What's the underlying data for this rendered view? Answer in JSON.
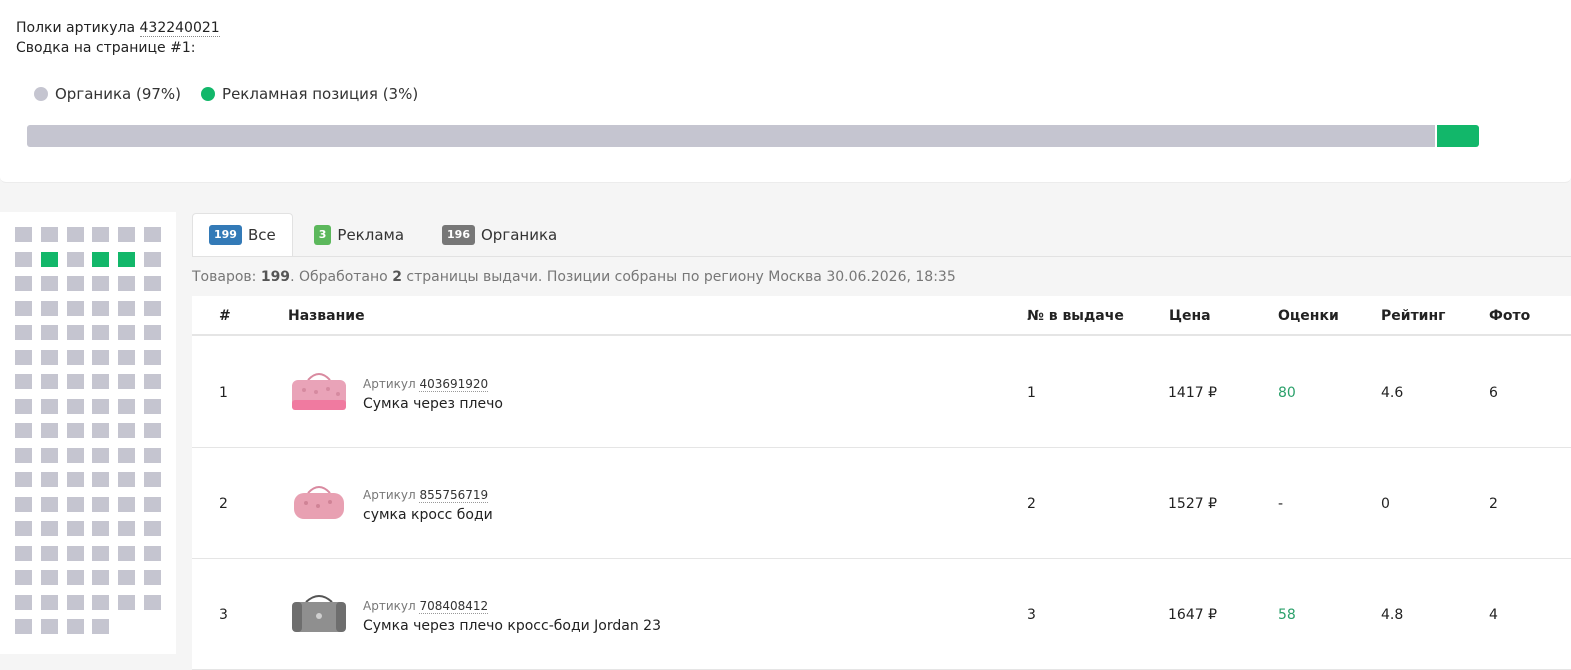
{
  "summary": {
    "title_prefix": "Полки артикула",
    "sku": "432240021",
    "subtitle": "Сводка на странице #1:",
    "legend": [
      {
        "label": "Органика (97%)",
        "color": "#c5c5d0"
      },
      {
        "label": "Рекламная позиция (3%)",
        "color": "#12b76a"
      }
    ],
    "organic_share_percent": 97,
    "ad_share_percent": 3
  },
  "position_map": {
    "total_cells": 100,
    "ad_positions": [
      8,
      10,
      11
    ],
    "colors": {
      "organic": "#c5c5d0",
      "ad": "#12b76a"
    }
  },
  "tabs": [
    {
      "count": "199",
      "label": "Все",
      "badge_color": "blue",
      "active": true
    },
    {
      "count": "3",
      "label": "Реклама",
      "badge_color": "green",
      "active": false
    },
    {
      "count": "196",
      "label": "Органика",
      "badge_color": "gray",
      "active": false
    }
  ],
  "info": {
    "goods_label": "Товаров:",
    "goods_count": "199",
    "processed_prefix": ". Обработано",
    "pages_count": "2",
    "processed_suffix": "страницы выдачи. Позиции собраны по региону Москва 30.06.2026, 18:35"
  },
  "table": {
    "headers": {
      "num": "#",
      "name": "Название",
      "position": "№ в выдаче",
      "price": "Цена",
      "reviews": "Оценки",
      "rating": "Рейтинг",
      "photo": "Фото"
    },
    "article_label": "Артикул",
    "rows": [
      {
        "num": "1",
        "article": "403691920",
        "name": "Сумка через плечо",
        "position": "1",
        "price": "1417 ₽",
        "reviews": "80",
        "rating": "4.6",
        "photo": "6",
        "thumb_color": "pink"
      },
      {
        "num": "2",
        "article": "855756719",
        "name": "сумка кросс боди",
        "position": "2",
        "price": "1527 ₽",
        "reviews": "-",
        "rating": "0",
        "photo": "2",
        "thumb_color": "pink"
      },
      {
        "num": "3",
        "article": "708408412",
        "name": "Сумка через плечо кросс-боди Jordan 23",
        "position": "3",
        "price": "1647 ₽",
        "reviews": "58",
        "rating": "4.8",
        "photo": "4",
        "thumb_color": "gray"
      }
    ]
  }
}
